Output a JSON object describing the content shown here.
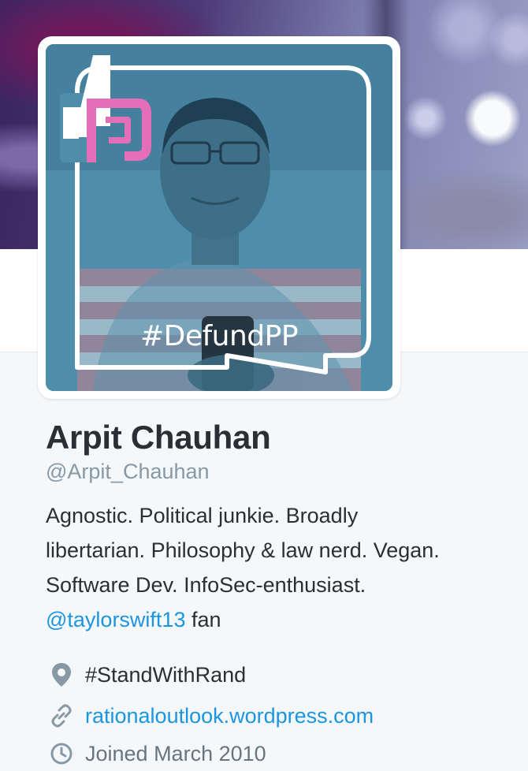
{
  "avatar": {
    "hashtag": "#DefundPP",
    "colors": {
      "tint": "#4f8eaa",
      "logo_pink": "#e36fb8",
      "frame_white": "#ffffff"
    }
  },
  "profile": {
    "display_name": "Arpit Chauhan",
    "screen_name": "@Arpit_Chauhan",
    "bio_line1": "Agnostic. Political junkie. Broadly",
    "bio_line2": "libertarian. Philosophy & law nerd. Vegan.",
    "bio_line3": "Software Dev. InfoSec-enthusiast.",
    "bio_mention": "@taylorswift13",
    "bio_suffix": " fan",
    "location": "#StandWithRand",
    "location_icon": "location-pin-icon",
    "website": "rationaloutlook.wordpress.com",
    "website_icon": "link-icon",
    "joined": "Joined March 2010",
    "joined_icon": "calendar-icon"
  },
  "colors": {
    "link": "#1b95e0",
    "text": "#292f33",
    "secondary": "#8899a6",
    "background": "#f5f8fa"
  }
}
